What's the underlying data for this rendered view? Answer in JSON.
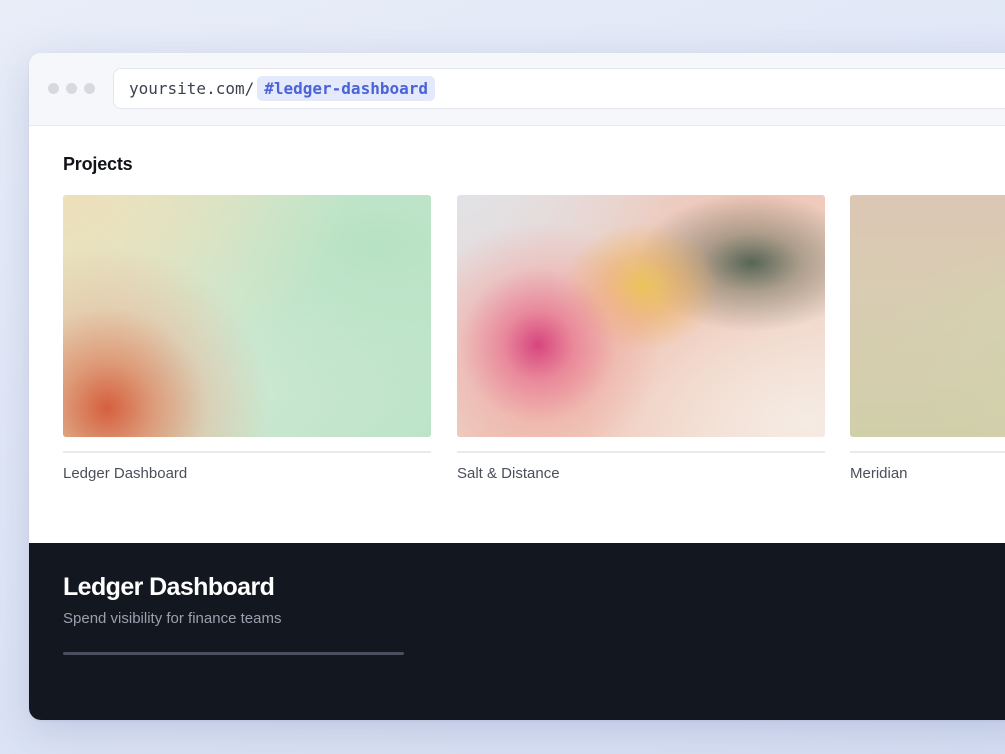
{
  "browser": {
    "url_base": "yoursite.com/",
    "url_hash": "#ledger-dashboard"
  },
  "projects": {
    "title": "Projects",
    "items": [
      {
        "label": "Ledger Dashboard",
        "thumbnail": "green-orange-gradient"
      },
      {
        "label": "Salt & Distance",
        "thumbnail": "pink-yellow-gradient"
      },
      {
        "label": "Meridian",
        "thumbnail": "beige-olive-gradient"
      }
    ]
  },
  "detail": {
    "title": "Ledger Dashboard",
    "subtitle": "Spend visibility for finance teams",
    "progress": 1.0
  },
  "colors": {
    "hash_highlight_bg": "#e4e9fb",
    "hash_highlight_text": "#4a63d6",
    "panel_bg": "#131720"
  }
}
